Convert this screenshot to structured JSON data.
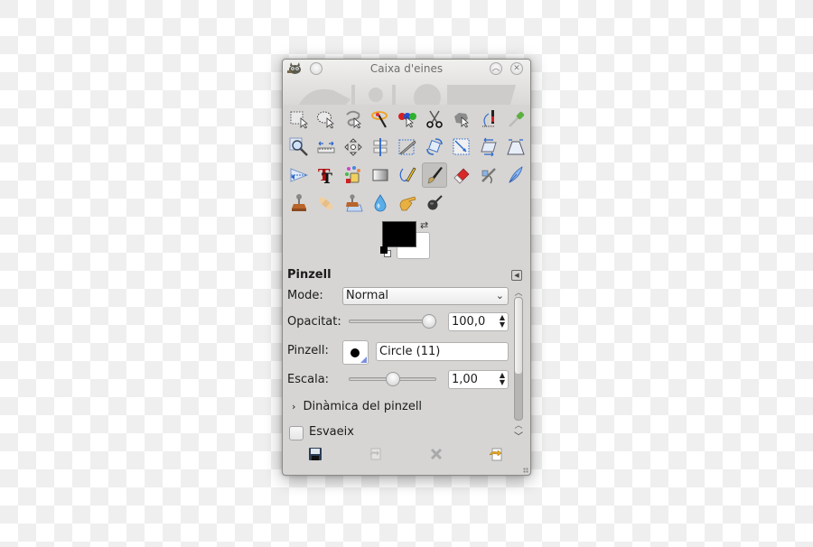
{
  "window": {
    "title": "Caixa d'eines",
    "buttons": [
      "menu",
      "maximize",
      "close"
    ]
  },
  "tools": [
    {
      "name": "rect-select",
      "label": "Selecció rectangular"
    },
    {
      "name": "ellipse-select",
      "label": "Selecció el·líptica"
    },
    {
      "name": "free-select",
      "label": "Selecció lliure"
    },
    {
      "name": "fuzzy-select",
      "label": "Selecció difusa"
    },
    {
      "name": "color-select",
      "label": "Selecció per color"
    },
    {
      "name": "scissors",
      "label": "Tisores intel·ligents"
    },
    {
      "name": "foreground-select",
      "label": "Selecció del primer pla"
    },
    {
      "name": "paths",
      "label": "Camins"
    },
    {
      "name": "color-picker",
      "label": "Selector de color"
    },
    {
      "name": "zoom",
      "label": "Zoom"
    },
    {
      "name": "measure",
      "label": "Mesura"
    },
    {
      "name": "move",
      "label": "Mou"
    },
    {
      "name": "align",
      "label": "Alinea"
    },
    {
      "name": "crop",
      "label": "Escapça"
    },
    {
      "name": "rotate",
      "label": "Gira"
    },
    {
      "name": "scale",
      "label": "Escala"
    },
    {
      "name": "shear",
      "label": "Inclina"
    },
    {
      "name": "perspective",
      "label": "Perspectiva"
    },
    {
      "name": "flip",
      "label": "Capgira"
    },
    {
      "name": "text",
      "label": "Text"
    },
    {
      "name": "bucket-fill",
      "label": "Emplena"
    },
    {
      "name": "blend",
      "label": "Degradat"
    },
    {
      "name": "pencil",
      "label": "Llapis"
    },
    {
      "name": "paintbrush",
      "label": "Pinzell",
      "active": true
    },
    {
      "name": "eraser",
      "label": "Goma"
    },
    {
      "name": "airbrush",
      "label": "Aerògraf"
    },
    {
      "name": "ink",
      "label": "Tinta"
    },
    {
      "name": "clone",
      "label": "Clona"
    },
    {
      "name": "heal",
      "label": "Guareix"
    },
    {
      "name": "perspective-clone",
      "label": "Clonació en perspectiva"
    },
    {
      "name": "blur-sharpen",
      "label": "Difumina/Aguditza"
    },
    {
      "name": "smudge",
      "label": "Esborrona"
    },
    {
      "name": "dodge-burn",
      "label": "Sobreexposa/Crema"
    }
  ],
  "colors": {
    "foreground": "#000000",
    "background": "#ffffff"
  },
  "options": {
    "title": "Pinzell",
    "mode_label": "Mode:",
    "mode_value": "Normal",
    "opacity_label": "Opacitat:",
    "opacity_value": "100,0",
    "opacity_fraction": 1.0,
    "brush_label": "Pinzell:",
    "brush_value": "Circle (11)",
    "scale_label": "Escala:",
    "scale_value": "1,00",
    "scale_fraction": 0.5,
    "dynamics_label": "Dinàmica del pinzell",
    "fade_label": "Esvaeix",
    "fade_checked": false
  },
  "bottom_buttons": [
    "save",
    "restore",
    "delete",
    "reset"
  ]
}
